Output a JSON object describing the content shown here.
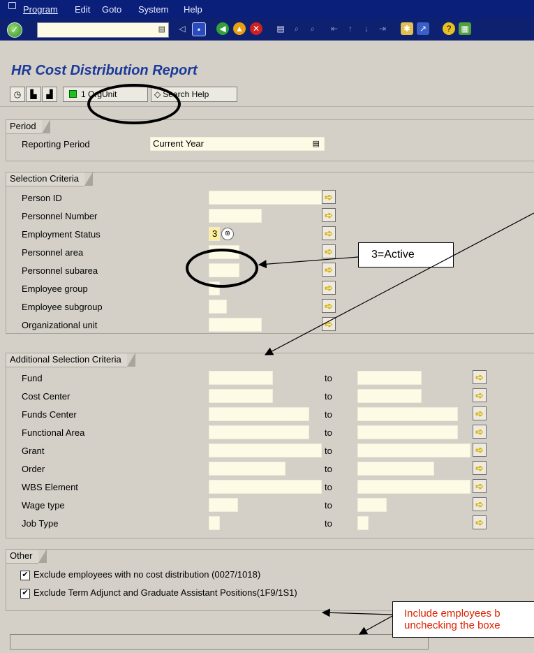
{
  "menubar": {
    "items": [
      "Program",
      "Edit",
      "Goto",
      "System",
      "Help"
    ]
  },
  "toolbar": {
    "command_value": "",
    "dropdown_icon": "dropdown-icon"
  },
  "page": {
    "title": "HR Cost Distribution Report"
  },
  "app_toolbar": {
    "orgunit_label": "1 OrgUnit",
    "search_help_label": "Search Help"
  },
  "period": {
    "title": "Period",
    "reporting_period_label": "Reporting Period",
    "reporting_period_value": "Current Year"
  },
  "selection": {
    "title": "Selection Criteria",
    "person_id": "Person ID",
    "personnel_number": "Personnel Number",
    "employment_status": "Employment Status",
    "employment_status_value": "3",
    "personnel_area": "Personnel area",
    "personnel_subarea": "Personnel subarea",
    "employee_group": "Employee group",
    "employee_subgroup": "Employee subgroup",
    "org_unit": "Organizational unit"
  },
  "additional": {
    "title": "Additional Selection Criteria",
    "to_label": "to",
    "fund": "Fund",
    "cost_center": "Cost Center",
    "funds_center": "Funds Center",
    "functional_area": "Functional Area",
    "grant": "Grant",
    "order": "Order",
    "wbs": "WBS Element",
    "wage_type": "Wage type",
    "job_type": "Job Type"
  },
  "other": {
    "title": "Other",
    "exclude_no_cost": "Exclude employees with no cost distribution (0027/1018)",
    "exclude_term": "Exclude Term Adjunct and Graduate Assistant Positions(1F9/1S1)",
    "check_mark": "✔"
  },
  "annotations": {
    "active_callout": "3=Active",
    "include_note_line1": "Include employees b",
    "include_note_line2": "unchecking the boxe"
  },
  "colors": {
    "title_blue": "#1a3a9a",
    "input_yellow": "#fdfbe6",
    "note_red": "#e02000",
    "menubar_blue": "#0a1f7a"
  }
}
